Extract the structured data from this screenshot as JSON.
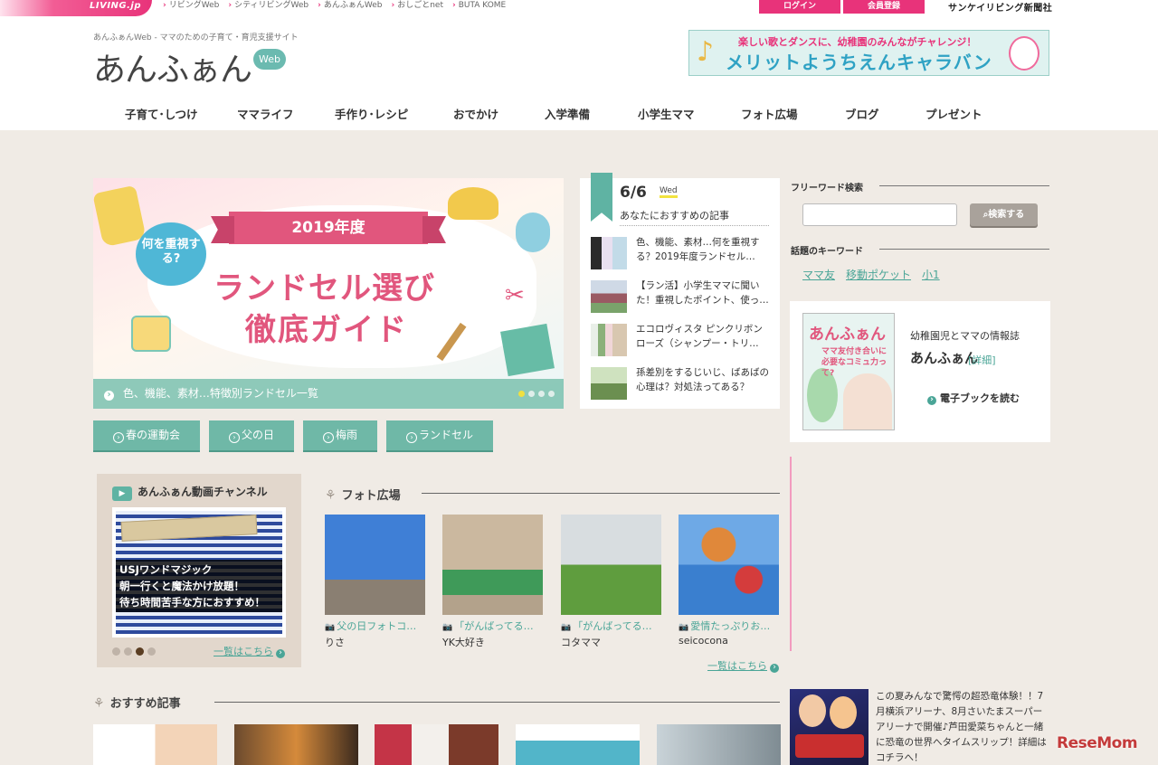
{
  "topbar": {
    "logo": "LIVING.jp",
    "links": [
      "リビングWeb",
      "シティリビングWeb",
      "あんふぁんWeb",
      "おしごとnet",
      "BUTA KOME"
    ],
    "login": "ログイン",
    "register": "会員登録",
    "company": "サンケイリビング新聞社"
  },
  "header": {
    "tagline": "あんふぁんWeb - ママのための子育て・育児支援サイト",
    "logo_main": "あんふぁん",
    "logo_badge": "Web",
    "banner_line1": "楽しい歌とダンスに、幼稚園のみんながチャレンジ！",
    "banner_line2": "メリットようちえんキャラバン"
  },
  "nav": [
    "子育て･しつけ",
    "ママライフ",
    "手作り･レシピ",
    "おでかけ",
    "入学準備",
    "小学生ママ",
    "フォト広場",
    "ブログ",
    "プレゼント"
  ],
  "hero": {
    "year_ribbon": "2019年度",
    "bubble": "何を重視する?",
    "title_line1": "ランドセル選び",
    "title_line2": "徹底ガイド",
    "caption": "色、機能、素材…特徴別ランドセル一覧"
  },
  "tags": [
    "春の運動会",
    "父の日",
    "梅雨",
    "ランドセル"
  ],
  "recommend": {
    "date": "6/6",
    "weekday": "Wed",
    "subtitle": "あなたにおすすめの記事",
    "items": [
      "色、機能、素材…何を重視する？2019年度ランドセル…",
      "【ラン活】小学生ママに聞いた！重視したポイント、使っ…",
      "エコロヴィスタ ピンクリボンローズ（シャンプー・トリ…",
      "孫差別をするじいじ、ばあばの心理は？対処法ってある？"
    ]
  },
  "video": {
    "title": "あんふぁん動画チャンネル",
    "thumb_line1": "USJワンドマジック",
    "thumb_line2": "朝一行くと魔法かけ放題！",
    "thumb_line3": "待ち時間苦手な方におすすめ！",
    "more": "一覧はこちら"
  },
  "photo": {
    "title": "フォト広場",
    "items": [
      {
        "caption": "父の日フォトコ…",
        "user": "りさ"
      },
      {
        "caption": "「がんばってる…",
        "user": "YK大好き"
      },
      {
        "caption": "「がんばってる…",
        "user": "コタママ"
      },
      {
        "caption": "愛情たっぷりお…",
        "user": "seicocona"
      }
    ],
    "more": "一覧はこちら"
  },
  "articles": {
    "title": "おすすめ記事"
  },
  "sidebar": {
    "search_title": "フリーワード検索",
    "search_button": "検索する",
    "keyword_title": "話題のキーワード",
    "keywords": [
      "ママ友",
      "移動ポケット",
      "小1"
    ],
    "mag_cover_title": "あんふぁん",
    "mag_cover_text": "ママ友付き合いに必要なコミュ力って?",
    "mag_desc1": "幼稚園児とママの情報誌",
    "mag_desc2": "あんふぁん",
    "mag_detail": "[詳細]",
    "mag_ebook": "電子ブックを読む",
    "ad_text": "この夏みんなで驚愕の超恐竜体験！！7月横浜アリーナ、8月さいたまスーパーアリーナで開催♪芦田愛菜ちゃんと一緒に恐竜の世界へタイムスリップ！詳細はコチラへ！"
  },
  "watermark": "ReseMom"
}
